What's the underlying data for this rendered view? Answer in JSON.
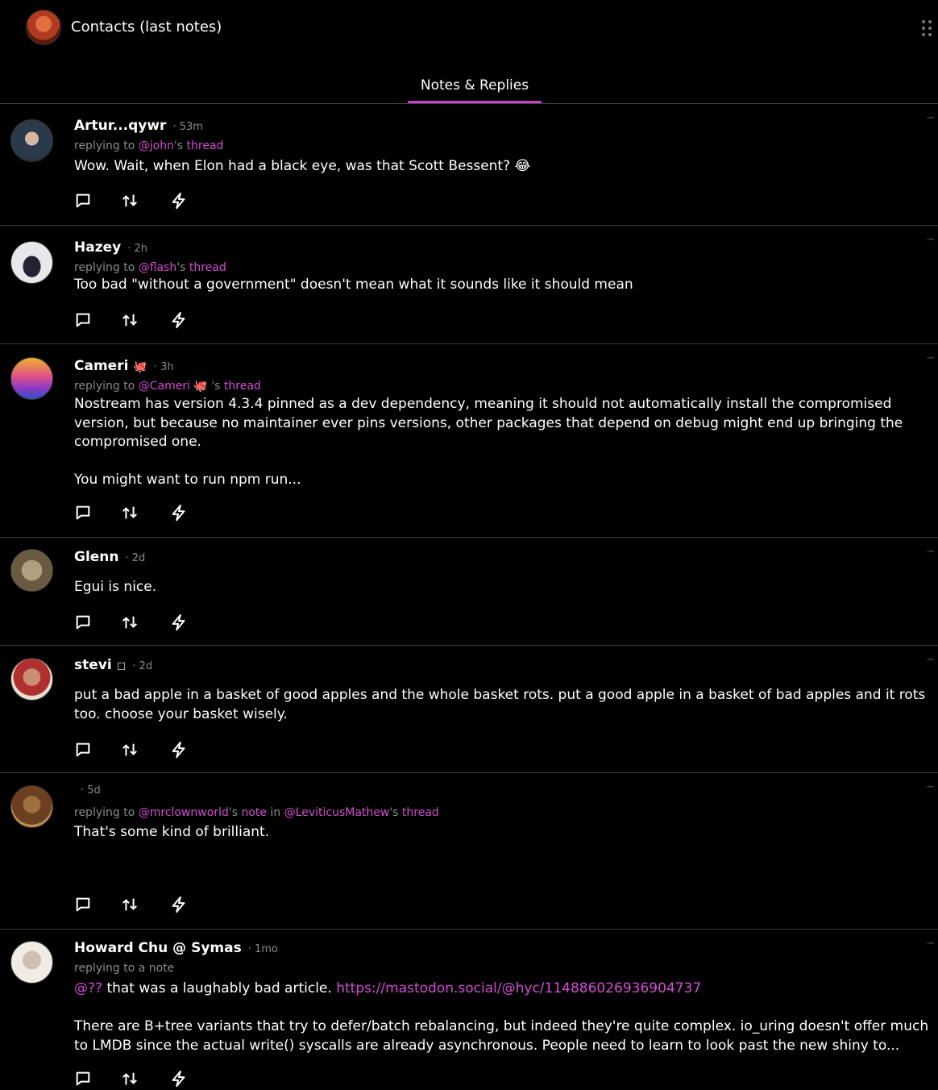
{
  "header": {
    "title": "Contacts (last notes)"
  },
  "tabs": [
    {
      "label": "Notes & Replies",
      "active": true
    }
  ],
  "accent_color": "#c540c5",
  "notes": [
    {
      "author": "Artur...qywr",
      "time": "· 53m",
      "reply": {
        "prefix": "replying to ",
        "mention": "@john",
        "suffix": "'s ",
        "link": "thread"
      },
      "content": "Wow. Wait, when Elon had a black eye, was that Scott Bessent? 😂"
    },
    {
      "author": "Hazey",
      "time": "· 2h",
      "reply": {
        "prefix": "replying to ",
        "mention": "@flash",
        "suffix": "'s ",
        "link": "thread"
      },
      "content": "Too bad \"without a government\" doesn't mean what it sounds like it should mean"
    },
    {
      "author": "Cameri",
      "badge": "🐙",
      "time": "· 3h",
      "reply": {
        "prefix": "replying to ",
        "mention": "@Cameri 🐙",
        "suffix": " 's ",
        "link": "thread"
      },
      "content": "Nostream has version 4.3.4 pinned as a dev dependency, meaning it should not automatically install the compromised version, but because no maintainer ever pins versions, other packages that depend on debug might end up bringing the compromised one.\n\nYou might want to run npm run..."
    },
    {
      "author": "Glenn",
      "time": "· 2d",
      "content": "Egui is nice."
    },
    {
      "author": "stevi",
      "badge": "◻",
      "time": "· 2d",
      "content": "put a bad apple in a basket of good apples and the whole basket rots. put a good apple in a basket of bad apples and it rots too. choose your basket wisely."
    },
    {
      "author": "",
      "time": "· 5d",
      "reply": {
        "prefix": "replying to ",
        "mention": "@mrclownworld",
        "suffix": "'s ",
        "link": "note",
        "middle": " in ",
        "mention2": "@LeviticusMathew",
        "suffix2": "'s ",
        "link2": "thread"
      },
      "content": "That's some kind of brilliant."
    },
    {
      "author": "Howard Chu @ Symas",
      "time": "· 1mo",
      "reply": {
        "prefix": "replying to a note"
      },
      "content_mention": "@??",
      "content_lead": " that was a laughably bad article. ",
      "content_url": "https://mastodon.social/@hyc/114886026936904737",
      "content": "There are B+tree variants that try to defer/batch rebalancing, but indeed they're quite complex. io_uring doesn't offer much to LMDB since the actual write() syscalls are already asynchronous. People need to learn to look past the new shiny to..."
    }
  ]
}
